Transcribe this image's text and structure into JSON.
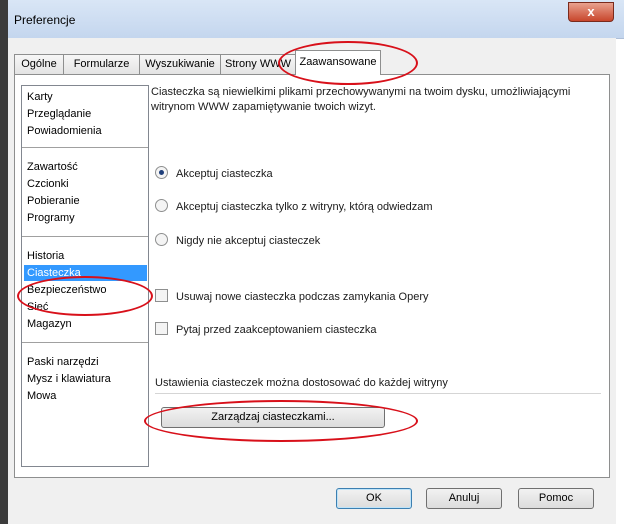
{
  "window": {
    "title": "Preferencje",
    "close_glyph": "x"
  },
  "tabs": [
    {
      "label": "Ogólne"
    },
    {
      "label": "Formularze"
    },
    {
      "label": "Wyszukiwanie"
    },
    {
      "label": "Strony WWW"
    },
    {
      "label": "Zaawansowane",
      "active": true
    }
  ],
  "sidebar": {
    "groups": [
      [
        "Karty",
        "Przeglądanie",
        "Powiadomienia"
      ],
      [
        "Zawartość",
        "Czcionki",
        "Pobieranie",
        "Programy"
      ],
      [
        "Historia",
        "Ciasteczka",
        "Bezpieczeństwo",
        "Sieć",
        "Magazyn"
      ],
      [
        "Paski narzędzi",
        "Mysz i klawiatura",
        "Mowa"
      ]
    ],
    "selected": "Ciasteczka"
  },
  "main": {
    "description": "Ciasteczka są niewielkimi plikami przechowywanymi na twoim dysku, umożliwiającymi witrynom WWW zapamiętywanie twoich wizyt.",
    "radios": [
      {
        "label": "Akceptuj ciasteczka",
        "checked": true
      },
      {
        "label": "Akceptuj ciasteczka tylko z witryny, którą odwiedzam",
        "checked": false
      },
      {
        "label": "Nigdy nie akceptuj ciasteczek",
        "checked": false
      }
    ],
    "checkboxes": [
      {
        "label": "Usuwaj nowe ciasteczka podczas zamykania Opery",
        "checked": false
      },
      {
        "label": "Pytaj przed zaakceptowaniem ciasteczka",
        "checked": false
      }
    ],
    "site_settings_text": "Ustawienia ciasteczek można dostosować do każdej witryny",
    "manage_button": "Zarządzaj ciasteczkami..."
  },
  "footer": {
    "ok": "OK",
    "cancel": "Anuluj",
    "help": "Pomoc"
  },
  "colors": {
    "selection": "#3399ff",
    "annotation": "#d8101a",
    "title_bar": "#c4d6ee"
  }
}
